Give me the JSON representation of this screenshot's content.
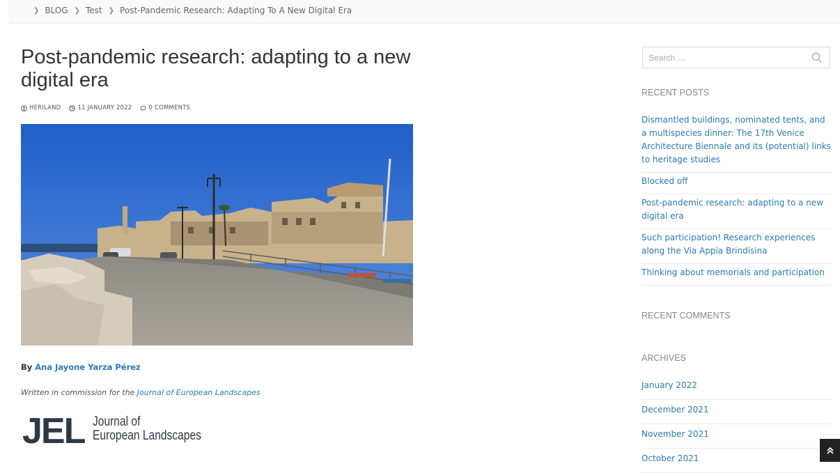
{
  "breadcrumb": {
    "items": [
      "BLOG",
      "Test"
    ],
    "current": "Post-Pandemic Research: Adapting To A New Digital Era"
  },
  "post": {
    "title": "Post-pandemic research: adapting to a new digital era",
    "author": "HERILAND",
    "date": "11 JANUARY 2022",
    "comments": "0 COMMENTS",
    "byline_prefix": "By ",
    "byline_author": "Ana Jayone Yarza Pérez",
    "commission_prefix": "Written in commission for the ",
    "commission_link": "Journal of European Landscapes",
    "logo": {
      "mark": "JEL",
      "line1": "Journal of",
      "line2": "European Landscapes"
    }
  },
  "sidebar": {
    "search_placeholder": "Search …",
    "recent_posts_title": "RECENT POSTS",
    "recent_posts": [
      "Dismantled buildings, nominated tents, and a multispecies dinner: The 17th Venice Architecture Biennale and its (potential) links to heritage studies",
      "Blocked off",
      "Post-pandemic research: adapting to a new digital era",
      "Such participation! Research experiences along the Via Appia Brindisina",
      "Thinking about memorials and participation"
    ],
    "recent_comments_title": "RECENT COMMENTS",
    "archives_title": "ARCHIVES",
    "archives": [
      "January 2022",
      "December 2021",
      "November 2021",
      "October 2021"
    ]
  },
  "icons": {
    "breadcrumb_separator": "chevron-right-icon",
    "author": "user-icon",
    "date": "clock-icon",
    "comments": "comment-icon",
    "search": "search-icon",
    "scroll_top": "double-chevron-up-icon"
  },
  "colors": {
    "link": "#2a7ab9",
    "text": "#333333",
    "muted": "#888888",
    "logo": "#2d3a46"
  }
}
